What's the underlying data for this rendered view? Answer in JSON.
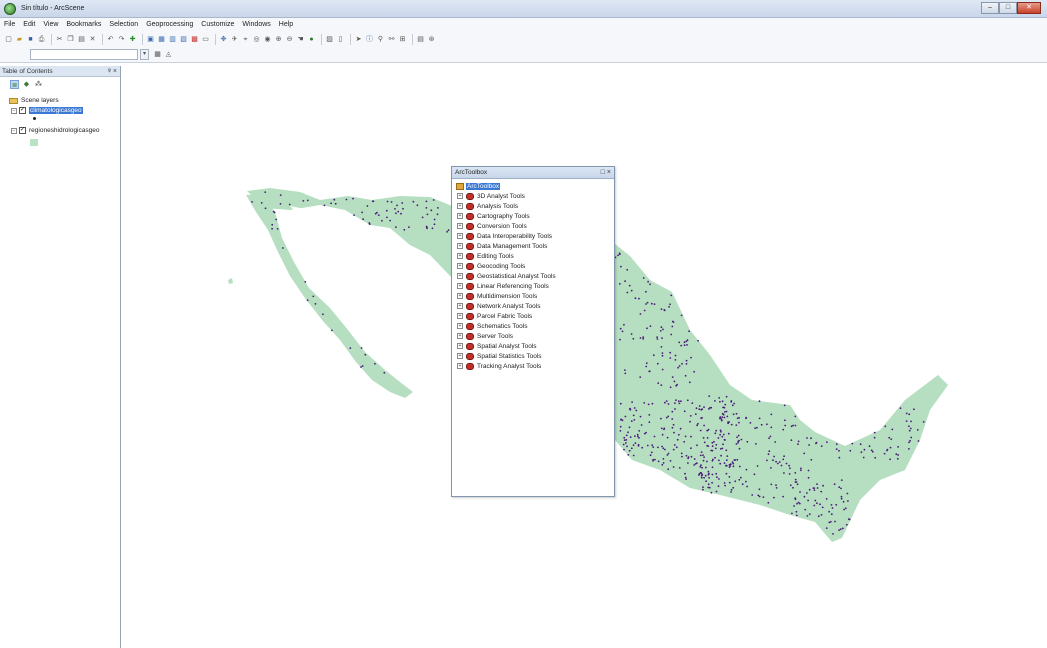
{
  "window": {
    "title": "Sin título - ArcScene"
  },
  "menu": [
    "File",
    "Edit",
    "View",
    "Bookmarks",
    "Selection",
    "Geoprocessing",
    "Customize",
    "Windows",
    "Help"
  ],
  "toc": {
    "title": "Table of Contents",
    "controls": "ᵠ ×",
    "root_label": "Scene layers",
    "layers": [
      {
        "label": "climatologicasgeo",
        "checked": true,
        "selected": true
      },
      {
        "label": "regioneshidrologicasgeo",
        "checked": true,
        "selected": false
      }
    ]
  },
  "toolbox": {
    "title": "ArcToolbox",
    "controls": "□ ×",
    "root_label": "ArcToolbox",
    "items": [
      "3D Analyst Tools",
      "Analysis Tools",
      "Cartography Tools",
      "Conversion Tools",
      "Data Interoperability Tools",
      "Data Management Tools",
      "Editing Tools",
      "Geocoding Tools",
      "Geostatistical Analyst Tools",
      "Linear Referencing Tools",
      "Multidimension Tools",
      "Network Analyst Tools",
      "Parcel Fabric Tools",
      "Schematics Tools",
      "Server Tools",
      "Spatial Analyst Tools",
      "Spatial Statistics Tools",
      "Tracking Analyst Tools"
    ]
  },
  "colors": {
    "land_fill": "#b5dfc0",
    "station_point": "#4b1a78",
    "selection_blue": "#3a78d4"
  }
}
